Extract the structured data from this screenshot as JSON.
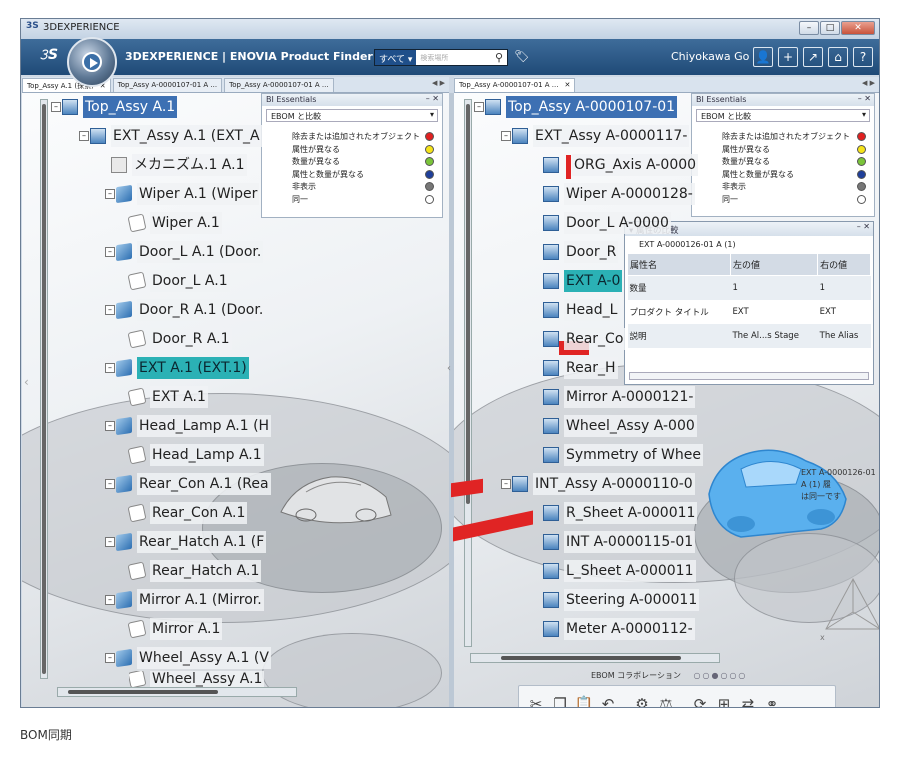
{
  "window": {
    "title": "3DEXPERIENCE"
  },
  "appbar": {
    "brand": "3DEXPERIENCE | ENOVIA Product Finder",
    "search_scope": "すべて ▾",
    "search_placeholder": "検索場所",
    "user": "Chiyokawa Go"
  },
  "left_tabs": [
    "Top_Assy A.1 (探索)",
    "Top_Assy A-0000107-01 A ...",
    "Top_Assy A-0000107-01 A ..."
  ],
  "right_tabs": [
    "Top_Assy A-0000107-01 A ..."
  ],
  "left_tree": {
    "root": "Top_Assy A.1",
    "ext": "EXT_Assy A.1 (EXT_A",
    "mech": "メカニズム.1 A.1",
    "wiper": "Wiper A.1 (Wiper",
    "wiper_part": "Wiper A.1",
    "doorl": "Door_L A.1 (Door.",
    "doorl_part": "Door_L A.1",
    "doorr": "Door_R A.1 (Door.",
    "doorr_part": "Door_R A.1",
    "extp": "EXT A.1 (EXT.1)",
    "extp_part": "EXT A.1",
    "head": "Head_Lamp A.1 (H",
    "head_part": "Head_Lamp A.1",
    "rearcon": "Rear_Con A.1 (Rea",
    "rearcon_part": "Rear_Con A.1",
    "rearhatch": "Rear_Hatch A.1 (F",
    "rearhatch_part": "Rear_Hatch A.1",
    "mirror": "Mirror A.1 (Mirror.",
    "mirror_part": "Mirror A.1",
    "wheel": "Wheel_Assy A.1 (V",
    "wheel_part": "Wheel_Assy A.1"
  },
  "right_tree": {
    "root": "Top_Assy A-0000107-01",
    "ext": "EXT_Assy A-0000117-",
    "org": "ORG_Axis A-0000",
    "wiper": "Wiper A-0000128-",
    "doorl": "Door_L A-0000",
    "doorr": "Door_R",
    "extp": "EXT A-0",
    "head": "Head_L",
    "rearcon": "Rear_Co",
    "rearh": "Rear_H",
    "mirror": "Mirror A-0000121-",
    "wheel": "Wheel_Assy A-000",
    "sym": "Symmetry of Whee",
    "int": "INT_Assy A-0000110-0",
    "rsheet": "R_Sheet A-000011",
    "intp": "INT A-0000115-01",
    "lsheet": "L_Sheet A-000011",
    "steer": "Steering A-000011",
    "meter": "Meter A-0000112-"
  },
  "bi_left": {
    "title": "BI Essentials",
    "select": "EBOM と比較",
    "legend": [
      "除去または追加されたオブジェクト",
      "属性が異なる",
      "数量が異なる",
      "属性と数量が異なる",
      "非表示",
      "同一"
    ]
  },
  "bi_right": {
    "title": "BI Essentials",
    "select": "EBOM と比較",
    "legend": [
      "除去または追加されたオブジェクト",
      "属性が異なる",
      "数量が異なる",
      "属性と数量が異なる",
      "非表示",
      "同一"
    ]
  },
  "legend_colors": [
    "#e02020",
    "#f5e31a",
    "#7ac43a",
    "#1f3f9a",
    "#777777",
    "#ffffff"
  ],
  "compare": {
    "title": "属性の比較",
    "object": "EXT A-0000126-01 A (1)",
    "headers": [
      "属性名",
      "左の値",
      "右の値"
    ],
    "rows": [
      [
        "数量",
        "1",
        "1"
      ],
      [
        "プロダクト タイトル",
        "EXT",
        "EXT"
      ],
      [
        "説明",
        "The Al...s Stage",
        "The Alias"
      ]
    ]
  },
  "note": {
    "line1": "EXT A-0000126-01 A (1) 履",
    "line2": "は同一です"
  },
  "collab": {
    "label": "EBOM コラボレーション",
    "dots": "○○●○○○"
  },
  "caption": "BOM同期"
}
